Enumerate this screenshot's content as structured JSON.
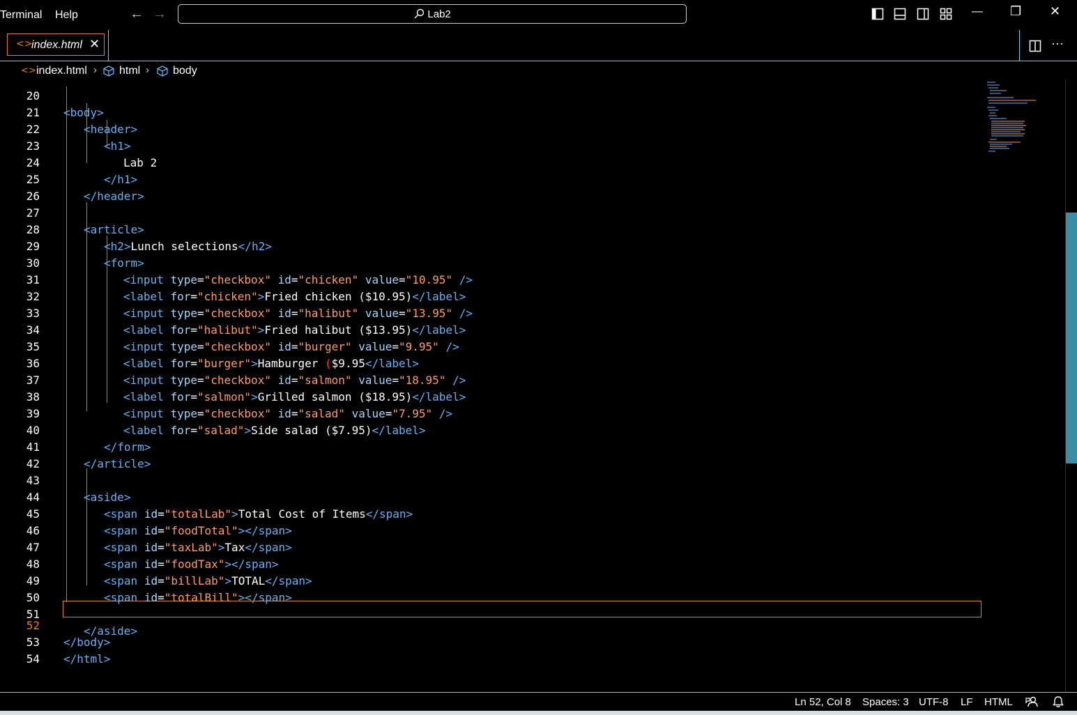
{
  "menu": {
    "terminal": "Terminal",
    "help": "Help"
  },
  "nav": {
    "back": "←",
    "forward": "→"
  },
  "command_center": {
    "label": "Lab2",
    "icon": "search-icon"
  },
  "window_controls": {
    "minimize": "—",
    "restore": "❐",
    "close": "✕"
  },
  "tab": {
    "label": "index.html",
    "icon": "<>",
    "close": "✕"
  },
  "breadcrumb": {
    "file": "index.html",
    "html": "html",
    "body": "body",
    "sep": "›"
  },
  "editor": {
    "top_partial": "<body>",
    "lines": [
      {
        "n": "20"
      },
      {
        "n": "21"
      },
      {
        "n": "22"
      },
      {
        "n": "23"
      },
      {
        "n": "24"
      },
      {
        "n": "25"
      },
      {
        "n": "26"
      },
      {
        "n": "27"
      },
      {
        "n": "28"
      },
      {
        "n": "29"
      },
      {
        "n": "30"
      },
      {
        "n": "31"
      },
      {
        "n": "32"
      },
      {
        "n": "33"
      },
      {
        "n": "34"
      },
      {
        "n": "35"
      },
      {
        "n": "36"
      },
      {
        "n": "37"
      },
      {
        "n": "38"
      },
      {
        "n": "39"
      },
      {
        "n": "40"
      },
      {
        "n": "41"
      },
      {
        "n": "42"
      },
      {
        "n": "43"
      },
      {
        "n": "44"
      },
      {
        "n": "45"
      },
      {
        "n": "46"
      },
      {
        "n": "47"
      },
      {
        "n": "48"
      },
      {
        "n": "49"
      },
      {
        "n": "50"
      },
      {
        "n": "51"
      },
      {
        "n": "52"
      },
      {
        "n": "53"
      },
      {
        "n": "54"
      }
    ],
    "text": {
      "header": "header",
      "h1": "h1",
      "lab2": "Lab 2",
      "article": "article",
      "h2": "h2",
      "lunch": "Lunch selections",
      "form": "form",
      "input": "input",
      "label": "label",
      "type": "type",
      "id": "id",
      "value": "value",
      "for": "for",
      "checkbox": "\"checkbox\"",
      "chicken": "\"chicken\"",
      "v_chicken": "\"10.95\"",
      "l_chicken": "Fried chicken ($10.95)",
      "halibut": "\"halibut\"",
      "v_halibut": "\"13.95\"",
      "l_halibut": "Fried halibut ($13.95)",
      "burger": "\"burger\"",
      "v_burger": "\"9.95\"",
      "l_burger_a": "Hamburger ",
      "l_burger_paren": "(",
      "l_burger_b": "$9.95",
      "salmon": "\"salmon\"",
      "v_salmon": "\"18.95\"",
      "l_salmon": "Grilled salmon ($18.95)",
      "salad": "\"salad\"",
      "v_salad": "\"7.95\"",
      "l_salad": "Side salad ($7.95)",
      "aside": "aside",
      "span": "span",
      "totalLab": "\"totalLab\"",
      "totalLabText": "Total Cost of Items",
      "foodTotal": "\"foodTotal\"",
      "taxLab": "\"taxLab\"",
      "taxText": "Tax",
      "foodTax": "\"foodTax\"",
      "billLab": "\"billLab\"",
      "billText": "TOTAL",
      "totalBill": "\"totalBill\"",
      "body": "body",
      "html": "html"
    }
  },
  "status": {
    "position": "Ln 52, Col 8",
    "spaces": "Spaces: 3",
    "encoding": "UTF-8",
    "eol": "LF",
    "language": "HTML"
  },
  "colors": {
    "accent_border": "#6ad2f0",
    "tab_border": "#e67e22",
    "tag": "#6ab0f3",
    "attr": "#a5d6ff",
    "string": "#ff9b6b"
  }
}
